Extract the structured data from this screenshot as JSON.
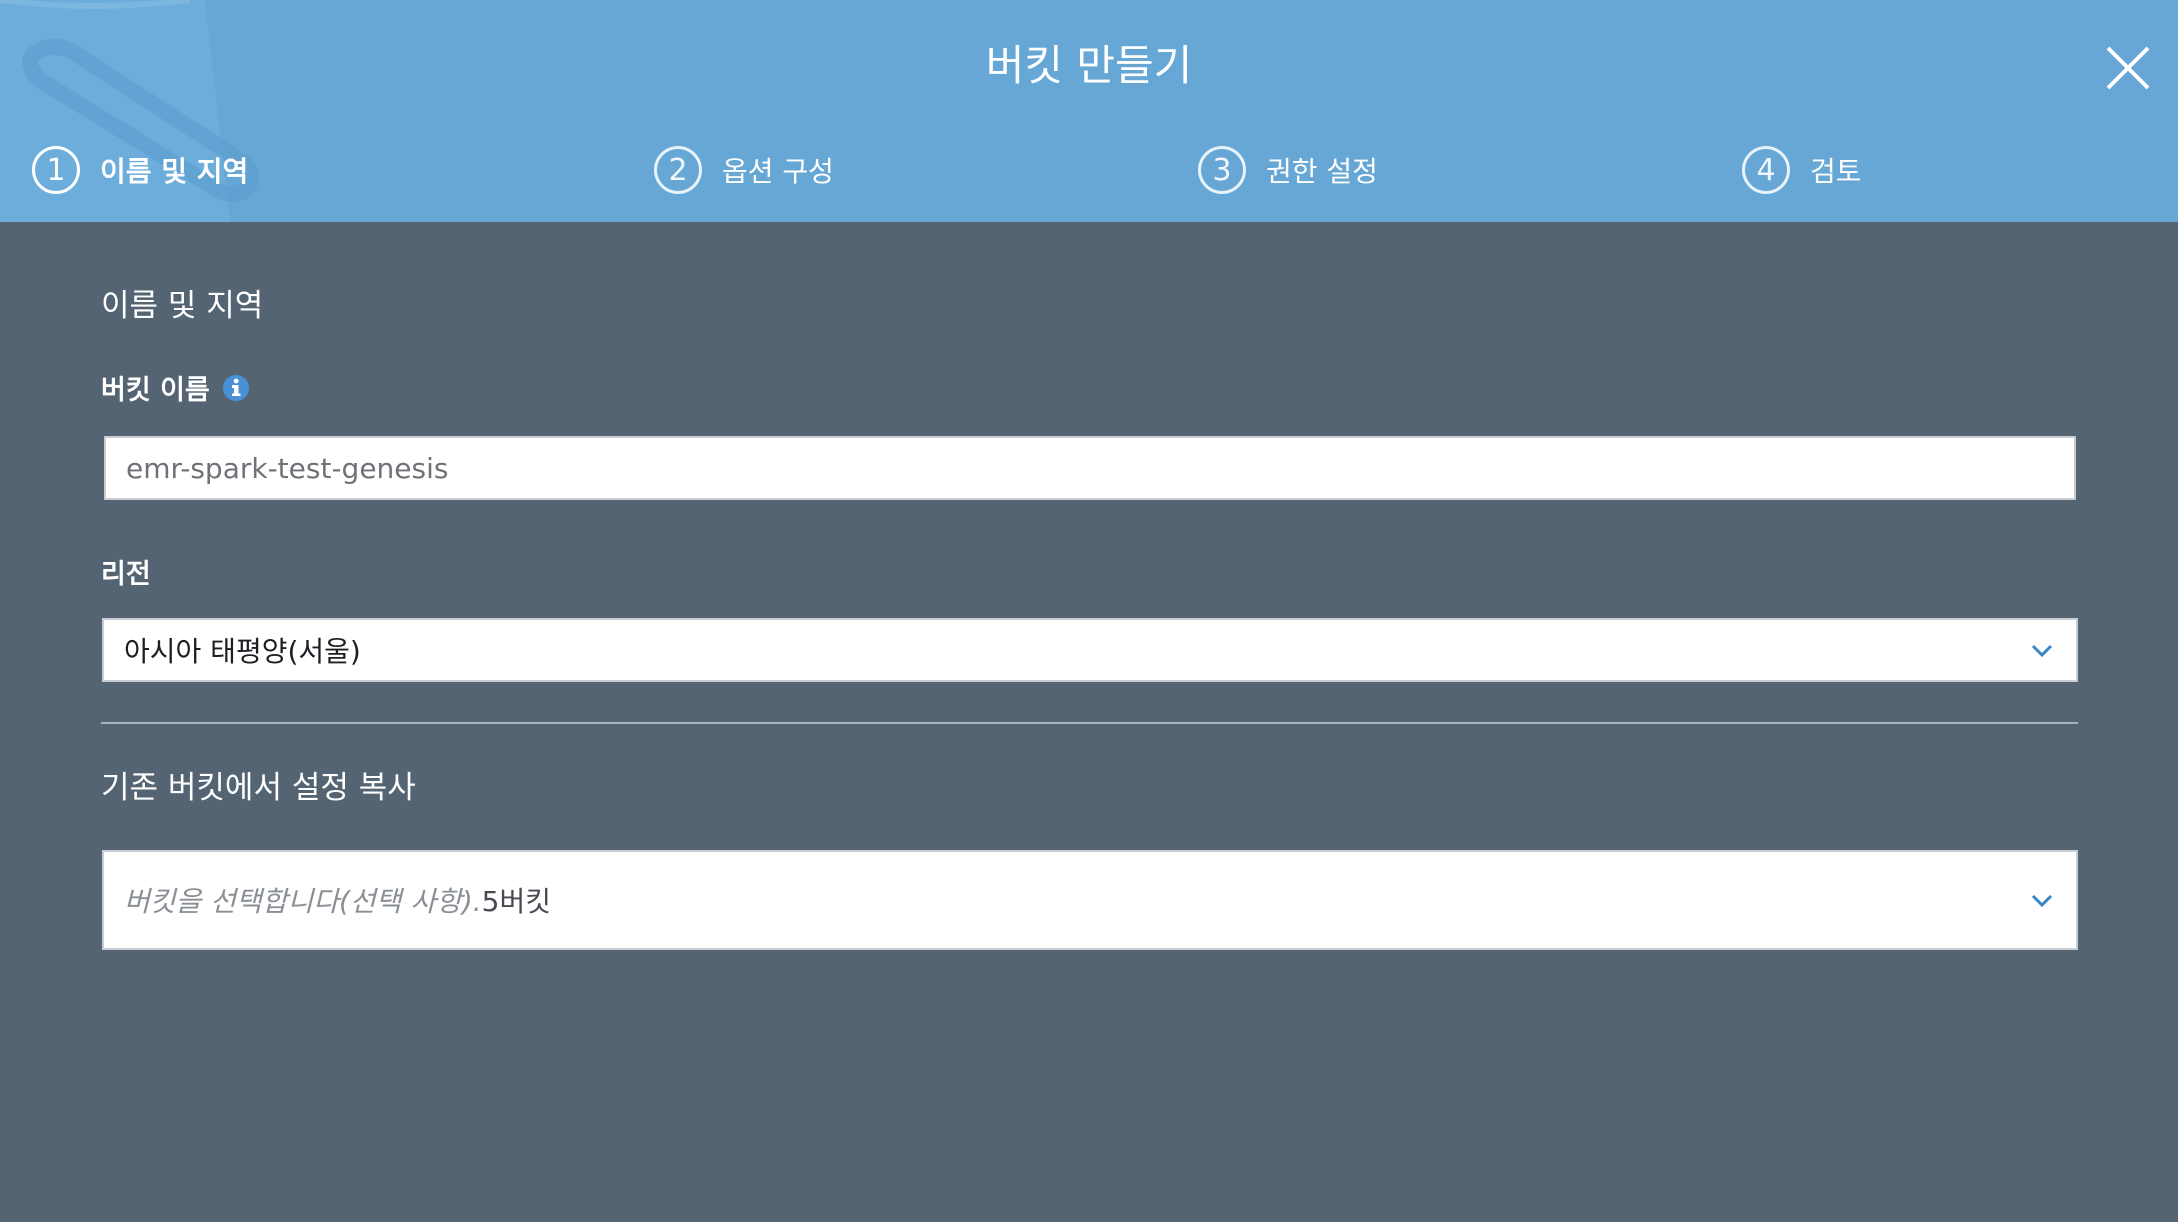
{
  "header": {
    "title": "버킷 만들기",
    "close_icon": "close-icon",
    "steps": [
      {
        "num": "1",
        "label": "이름 및 지역"
      },
      {
        "num": "2",
        "label": "옵션 구성"
      },
      {
        "num": "3",
        "label": "권한 설정"
      },
      {
        "num": "4",
        "label": "검토"
      }
    ]
  },
  "main": {
    "section_title": "이름 및 지역",
    "bucket_name_label": "버킷 이름",
    "bucket_name_value": "emr-spark-test-genesis",
    "region_label": "리전",
    "region_value": "아시아 태평양(서울)",
    "copy_section_title": "기존 버킷에서 설정 복사",
    "copy_placeholder": "버킷을 선택합니다(선택 사항).",
    "copy_count": "5버킷"
  },
  "colors": {
    "header_bg": "#66a7d6",
    "body_bg": "#546473",
    "info_icon": "#4a90d6"
  }
}
